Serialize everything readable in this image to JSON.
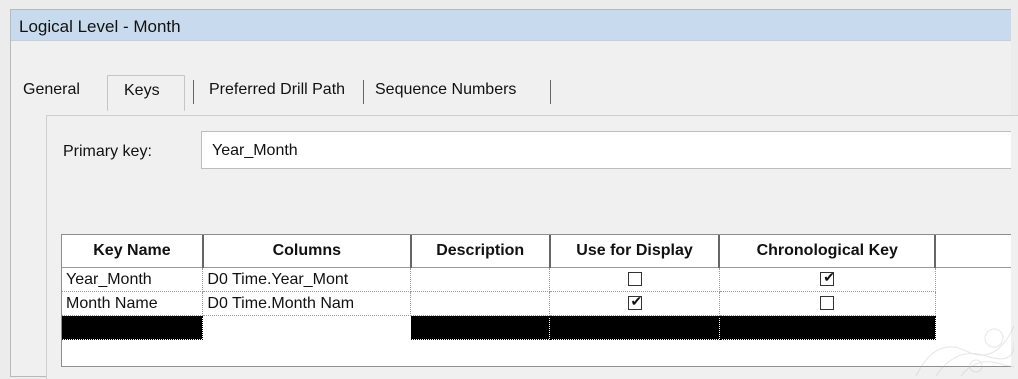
{
  "window": {
    "title": "Logical Level - Month"
  },
  "tabs": [
    {
      "label": "General",
      "selected": false
    },
    {
      "label": "Keys",
      "selected": true
    },
    {
      "label": "Preferred Drill Path",
      "selected": false
    },
    {
      "label": "Sequence Numbers",
      "selected": false
    }
  ],
  "primary_key": {
    "label": "Primary key:",
    "value": "Year_Month"
  },
  "grid": {
    "columns": [
      "Key Name",
      "Columns",
      "Description",
      "Use for Display",
      "Chronological Key"
    ],
    "rows": [
      {
        "key_name": "Year_Month",
        "columns": "D0 Time.Year_Mont",
        "description": "",
        "use_for_display": false,
        "chronological_key": true
      },
      {
        "key_name": "Month Name",
        "columns": "D0 Time.Month Nam",
        "description": "",
        "use_for_display": true,
        "chronological_key": false
      }
    ]
  },
  "colors": {
    "titlebar": "#c8dbee",
    "selection_row": "#000000"
  }
}
